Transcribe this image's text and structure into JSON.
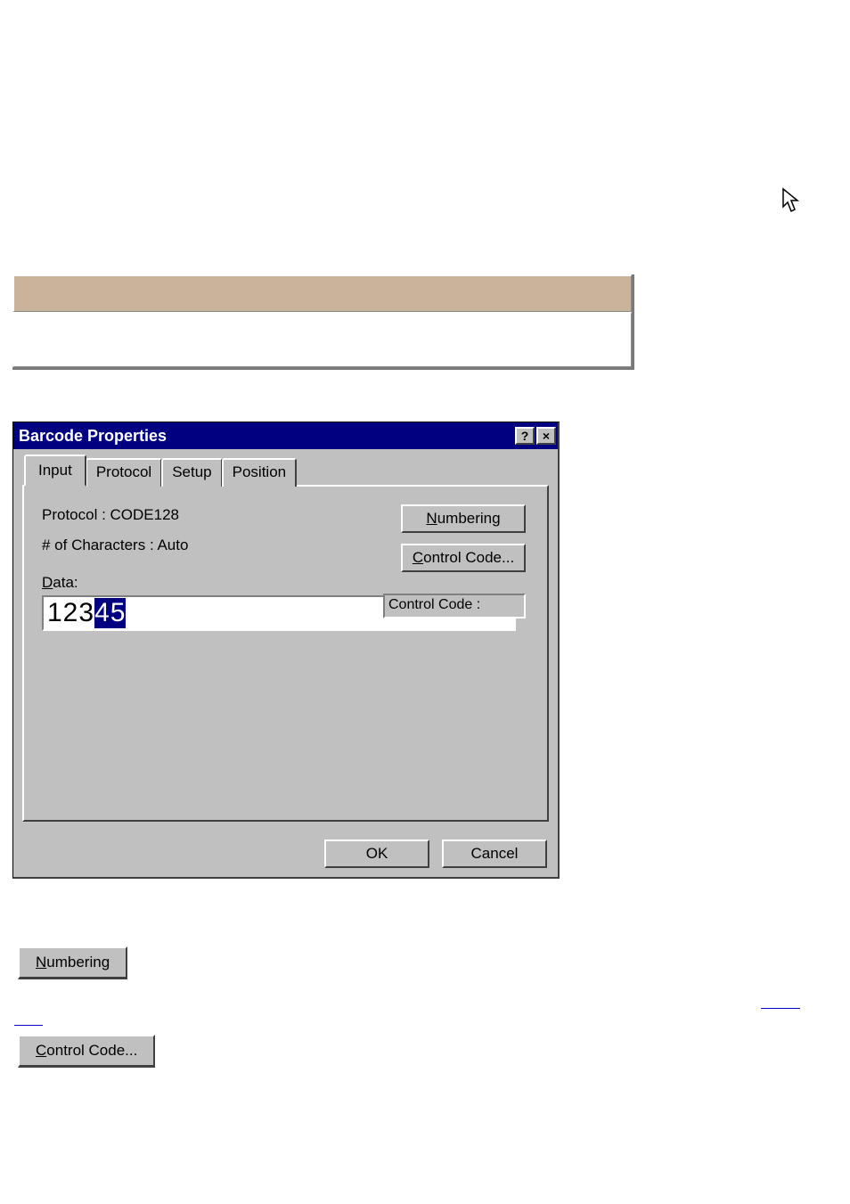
{
  "cursor": {
    "glyph": "↖"
  },
  "panel": {
    "top": "",
    "bottom": ""
  },
  "dialog": {
    "title": "Barcode Properties",
    "helpGlyph": "?",
    "closeGlyph": "×",
    "tabs": {
      "input": "Input",
      "protocol": "Protocol",
      "setup": "Setup",
      "position": "Position"
    },
    "protocolLine": "Protocol : CODE128",
    "charsLine": "# of Characters : Auto",
    "buttons": {
      "numbering": "Numbering",
      "controlCode": "Control Code..."
    },
    "controlCodeLabel": "Control Code :",
    "dataLabel": "Data:",
    "dataUnselected": "123",
    "dataSelected": "45",
    "ok": "OK",
    "cancel": "Cancel"
  },
  "standalone": {
    "numbering": "Numbering",
    "controlCode": "Control Code..."
  }
}
